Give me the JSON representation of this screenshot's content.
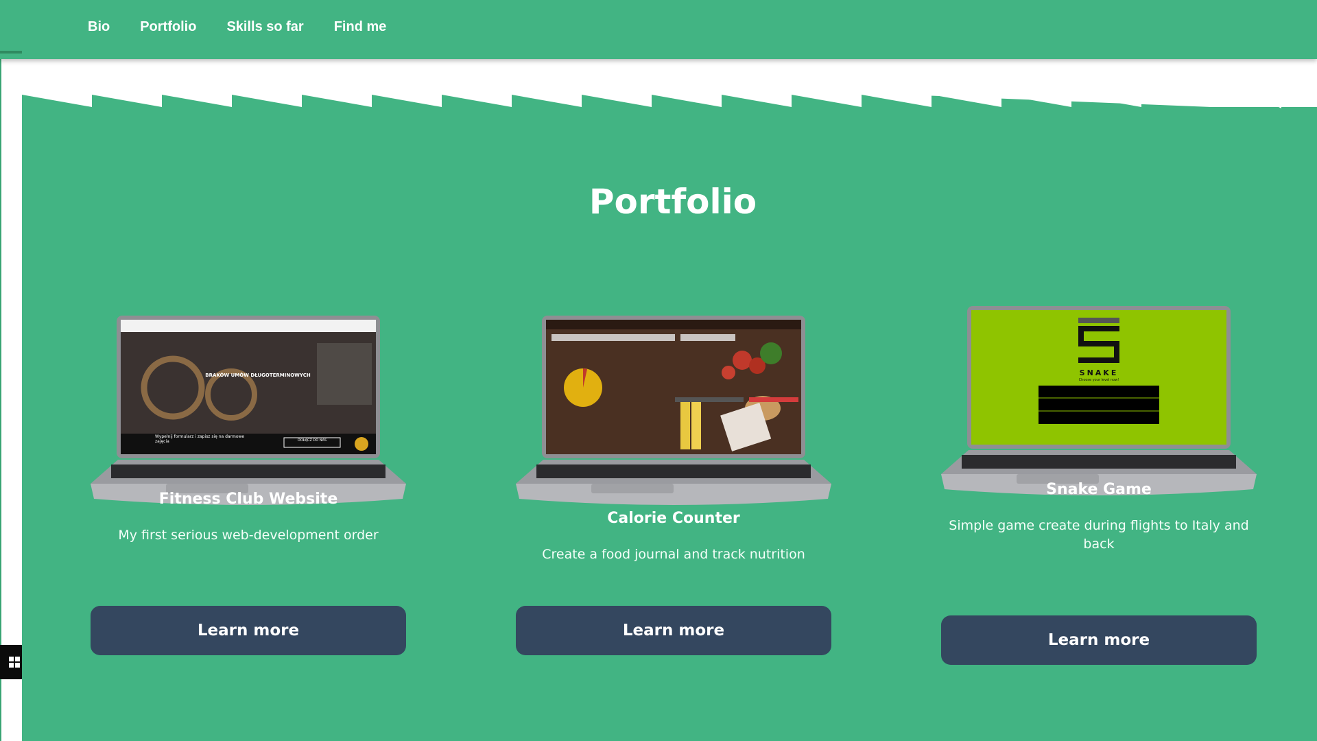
{
  "nav": {
    "items": [
      "Bio",
      "Portfolio",
      "Skills so far",
      "Find me"
    ]
  },
  "portfolio": {
    "title": "Portfolio",
    "projects": [
      {
        "title": "Fitness Club Website",
        "description": "My first serious web-development order",
        "button": "Learn more",
        "screen": {
          "headline": "BRAKÓW UMÓW DŁUGOTERMINOWYCH",
          "cta_text": "Wypełnij formularz i zapisz się na darmowe zajęcia",
          "cta_button": "DOŁĄCZ DO NAS"
        }
      },
      {
        "title": "Calorie Counter",
        "description": "Create a food journal and track nutrition",
        "button": "Learn more"
      },
      {
        "title": "Snake Game",
        "description": "Simple game create during flights to Italy and back",
        "button": "Learn more",
        "screen": {
          "logo_text": "SNAKE",
          "tagline": "Choose your level now!"
        }
      }
    ]
  },
  "colors": {
    "brand_green": "#42b483",
    "button_navy": "#34475f",
    "white": "#ffffff"
  },
  "icons": {
    "windows_badge": "windows-icon"
  }
}
